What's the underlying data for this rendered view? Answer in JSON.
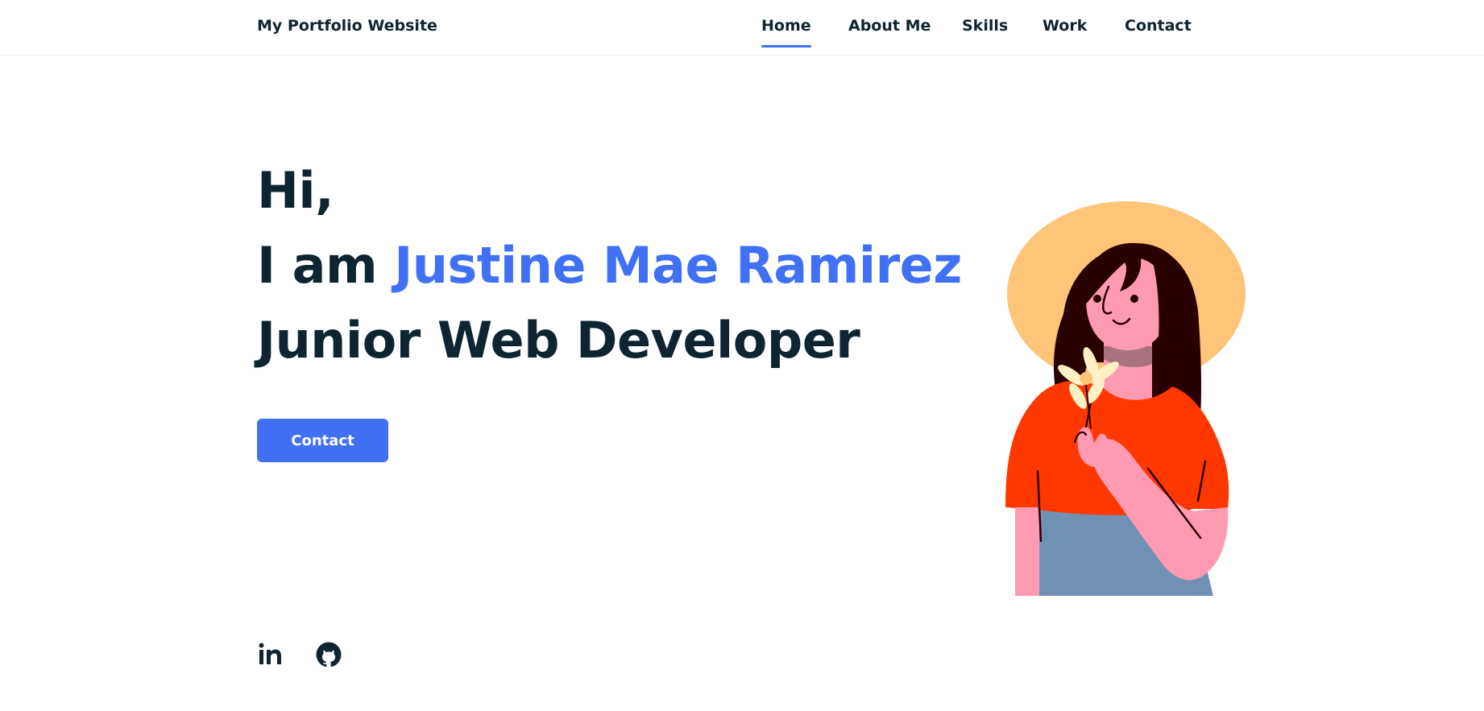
{
  "header": {
    "logo": "My Portfolio Website",
    "nav": [
      {
        "label": "Home",
        "active": true
      },
      {
        "label": "About Me",
        "active": false
      },
      {
        "label": "Skills",
        "active": false
      },
      {
        "label": "Work",
        "active": false
      },
      {
        "label": "Contact",
        "active": false
      }
    ]
  },
  "hero": {
    "line1": "Hi,",
    "line2_prefix": "I am ",
    "name": "Justine Mae Ramirez",
    "line3": "Junior Web Developer",
    "button_label": "Contact"
  },
  "social": [
    {
      "icon": "linkedin-icon"
    },
    {
      "icon": "github-icon"
    }
  ],
  "colors": {
    "accent": "#4070f4",
    "text": "#0e2431"
  }
}
